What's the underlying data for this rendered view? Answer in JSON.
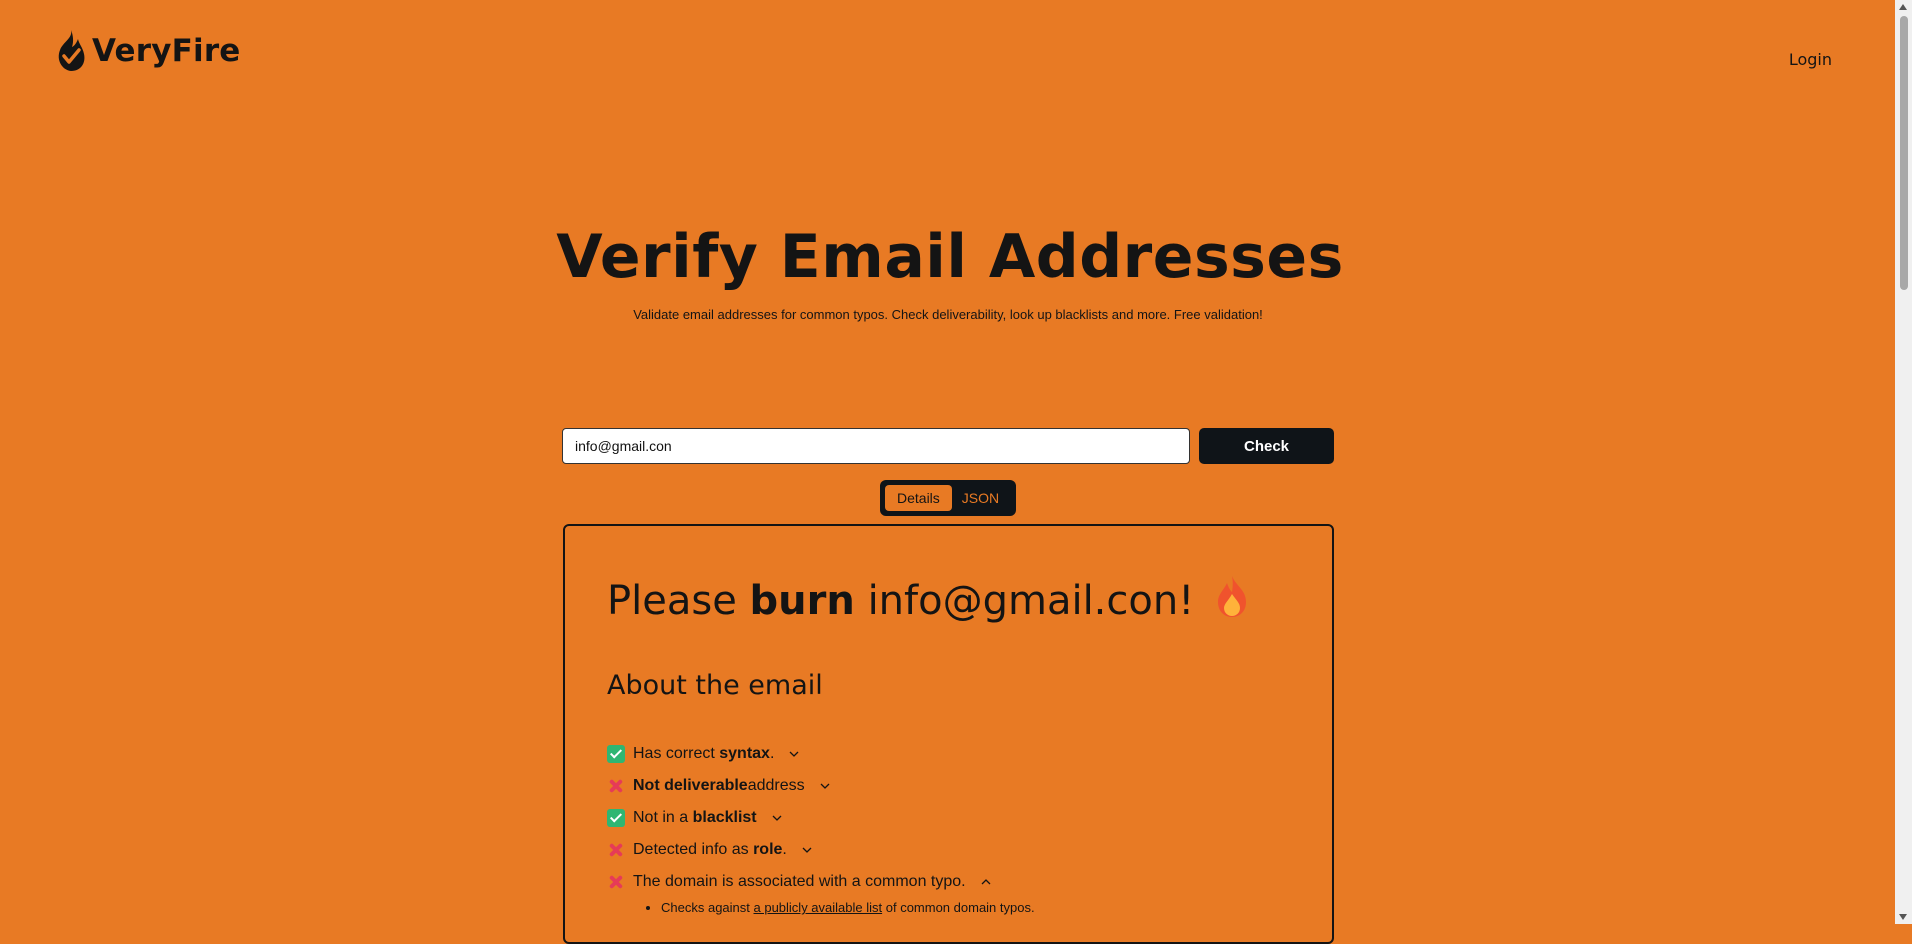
{
  "header": {
    "brand": "VeryFire",
    "login_label": "Login"
  },
  "hero": {
    "title": "Verify Email Addresses",
    "subtitle": "Validate email addresses for common typos. Check deliverability, look up blacklists and more. Free validation!"
  },
  "search": {
    "value": "info@gmail.con",
    "button_label": "Check"
  },
  "tabs": {
    "details": "Details",
    "json": "JSON"
  },
  "result": {
    "prefix": "Please ",
    "verb": "burn",
    "email": "info@gmail.con!",
    "about_heading": "About the email",
    "checks": [
      {
        "pre": "Has correct ",
        "bold": "syntax",
        "post": ".",
        "status": "ok"
      },
      {
        "pre": "",
        "bold": "Not deliverable",
        "post": " address",
        "status": "bad"
      },
      {
        "pre": "Not in a ",
        "bold": "blacklist",
        "post": "",
        "status": "ok"
      },
      {
        "pre": "Detected info as ",
        "bold": "role",
        "post": ".",
        "status": "bad"
      },
      {
        "pre": "The domain is associated with a common typo.",
        "bold": "",
        "post": "",
        "status": "bad"
      }
    ],
    "typo_details": {
      "pre": "Checks against ",
      "link": "a publicly available list",
      "post": " of common domain typos."
    }
  },
  "colors": {
    "background": "#E87A24",
    "dark": "#0f1418",
    "ok": "#2fb672",
    "bad": "#e63b57"
  }
}
